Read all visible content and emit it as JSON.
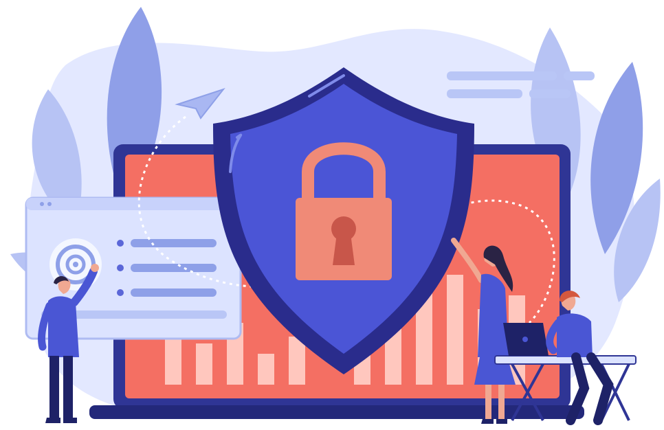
{
  "illustration": {
    "subject": "cybersecurity",
    "icons": [
      "shield-icon",
      "padlock-icon",
      "paper-plane-icon",
      "fingerprint-icon",
      "laptop-icon"
    ],
    "colors": {
      "background_blob": "#E3E8FF",
      "leaf_light": "#B7C3F4",
      "leaf_mid": "#8F9FE8",
      "shield_outer": "#2A2C8C",
      "shield_inner": "#4B55D6",
      "lock": "#F08A77",
      "lock_dark": "#C8564A",
      "monitor_frame": "#2F3595",
      "screen": "#F46F63",
      "bars": "#FFC7BE",
      "panel": "#DCE3FF",
      "text_lines": "#8EA0E8",
      "person_shirt": "#4A56D4",
      "person_pants": "#1E2267",
      "skin": "#F0A892",
      "hair_dark": "#2A2344",
      "hair_red": "#D4583E"
    }
  }
}
